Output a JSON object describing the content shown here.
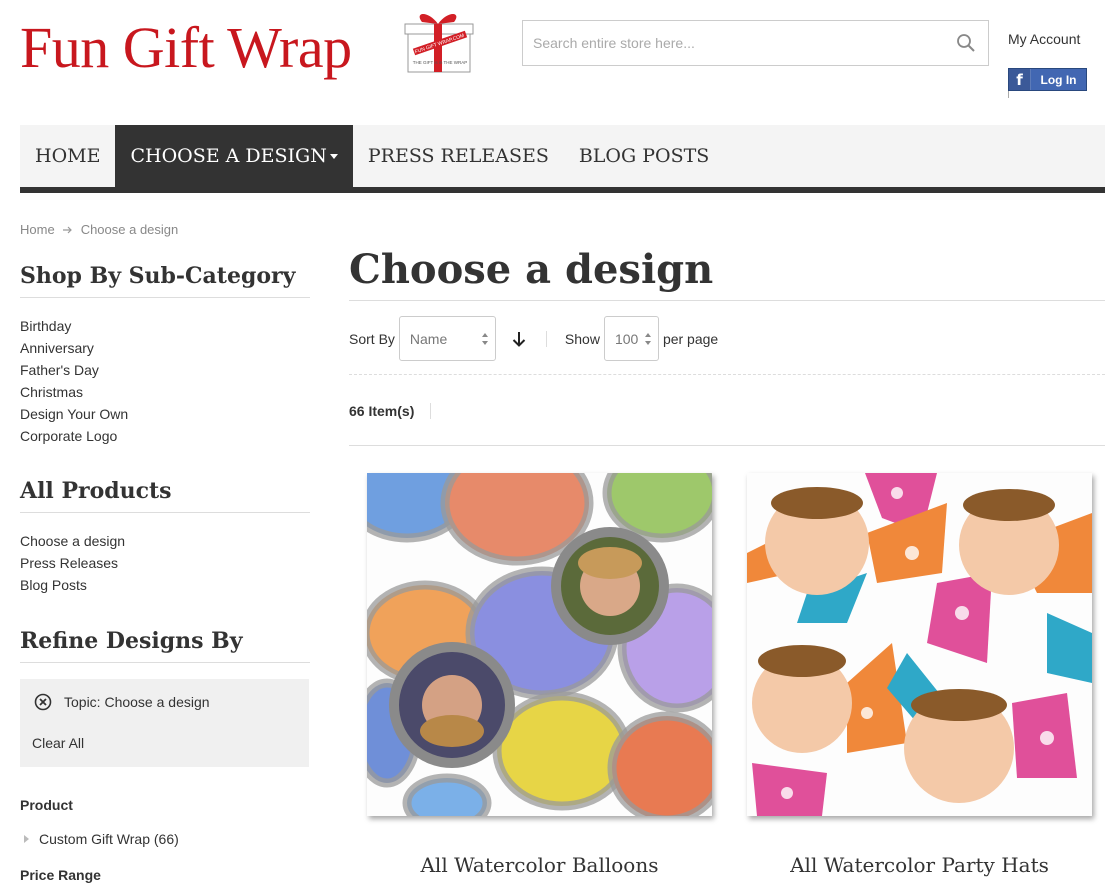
{
  "header": {
    "logo_text": "Fun Gift Wrap",
    "logo_box_text": "FUN GIFT WRAP.COM",
    "logo_box_tag": "THE GIFT is in THE WRAP",
    "search_placeholder": "Search entire store here...",
    "my_account": "My Account",
    "fb_login": "Log In"
  },
  "nav": {
    "items": [
      "HOME",
      "CHOOSE A DESIGN",
      "PRESS RELEASES",
      "BLOG POSTS"
    ]
  },
  "breadcrumb": {
    "home": "Home",
    "current": "Choose a design"
  },
  "sidebar": {
    "subcat_title": "Shop By Sub-Category",
    "subcats": [
      "Birthday",
      "Anniversary",
      "Father's Day",
      "Christmas",
      "Design Your Own",
      "Corporate Logo"
    ],
    "all_products_title": "All Products",
    "all_products": [
      "Choose a design",
      "Press Releases",
      "Blog Posts"
    ],
    "refine_title": "Refine Designs By",
    "active_filter": "Topic: Choose a design",
    "clear_all": "Clear All",
    "product_title": "Product",
    "product_option": "Custom Gift Wrap (66)",
    "price_title": "Price Range"
  },
  "main": {
    "title": "Choose a design",
    "sort_by_label": "Sort By",
    "sort_value": "Name",
    "show_label": "Show",
    "per_page_value": "100",
    "per_page_label": "per page",
    "item_count": "66 Item(s)",
    "products": [
      {
        "name": "All Watercolor Balloons"
      },
      {
        "name": "All Watercolor Party Hats"
      }
    ]
  },
  "colors": {
    "brand_red": "#c8171e",
    "nav_dark": "#333333",
    "facebook": "#4267b2"
  }
}
